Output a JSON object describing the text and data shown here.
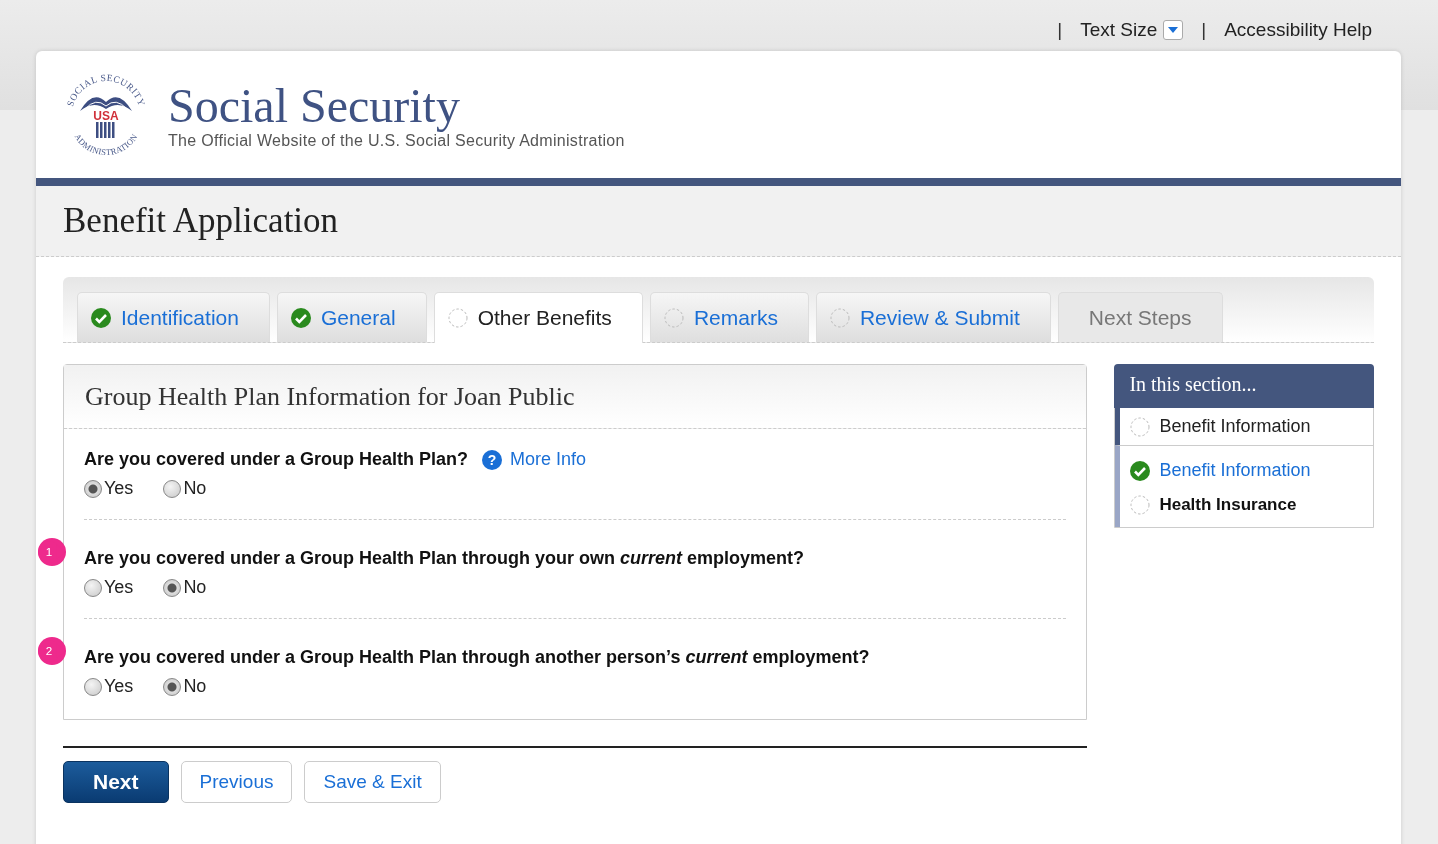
{
  "top_bar": [
    {
      "kind": "separator",
      "text": "|"
    },
    {
      "kind": "dropdown",
      "label": "Text Size"
    },
    {
      "kind": "separator",
      "text": "|"
    },
    {
      "kind": "link",
      "label": "Accessibility Help"
    }
  ],
  "logo": {
    "top_text": "SOCIAL SECURITY",
    "center_text": "USA",
    "bottom_text": "ADMINISTRATION"
  },
  "site_title": "Social Security",
  "site_subtitle": "The Official Website of the U.S. Social Security Administration",
  "page_title": "Benefit Application",
  "tabs": [
    {
      "label": "Identification",
      "kind": "complete",
      "selected": false,
      "disabled": false
    },
    {
      "label": "General",
      "kind": "complete",
      "selected": false,
      "disabled": false
    },
    {
      "label": "Other Benefits",
      "kind": "incomplete",
      "selected": true,
      "disabled": false
    },
    {
      "label": "Remarks",
      "kind": "incomplete",
      "selected": false,
      "disabled": false
    },
    {
      "label": "Review & Submit",
      "kind": "incomplete",
      "selected": false,
      "disabled": false
    },
    {
      "label": "Next Steps",
      "kind": "plain",
      "selected": false,
      "disabled": true
    }
  ],
  "panel": {
    "title": "Group Health Plan Information for Joan Public",
    "questions": [
      {
        "text": "Are you covered under a Group Health Plan?",
        "help_icon": "?",
        "more_info": "More Info",
        "options": [
          {
            "label": "Yes",
            "selected": true
          },
          {
            "label": "No",
            "selected": false
          }
        ]
      },
      {
        "marker": "1",
        "text": "Are you covered under a Group Health Plan through your own *current* employment?",
        "options": [
          {
            "label": "Yes",
            "selected": false
          },
          {
            "label": "No",
            "selected": true
          }
        ]
      },
      {
        "marker": "2",
        "text": "Are you covered under a Group Health Plan through another person’s *current* employment?",
        "options": [
          {
            "label": "Yes",
            "selected": false
          },
          {
            "label": "No",
            "selected": true
          }
        ]
      }
    ]
  },
  "buttons": [
    {
      "label": "Next",
      "kind": "primary"
    },
    {
      "label": "Previous",
      "kind": "secondary"
    },
    {
      "label": "Save & Exit",
      "kind": "secondary"
    }
  ],
  "sidebar": {
    "title": "In this section...",
    "groups": [
      {
        "items": [
          {
            "label": "Benefit Information",
            "kind": "incomplete",
            "current": false
          }
        ]
      },
      {
        "items": [
          {
            "label": "Benefit Information",
            "kind": "complete",
            "current": false
          },
          {
            "label": "Health Insurance",
            "kind": "incomplete",
            "current": true
          }
        ]
      }
    ]
  }
}
